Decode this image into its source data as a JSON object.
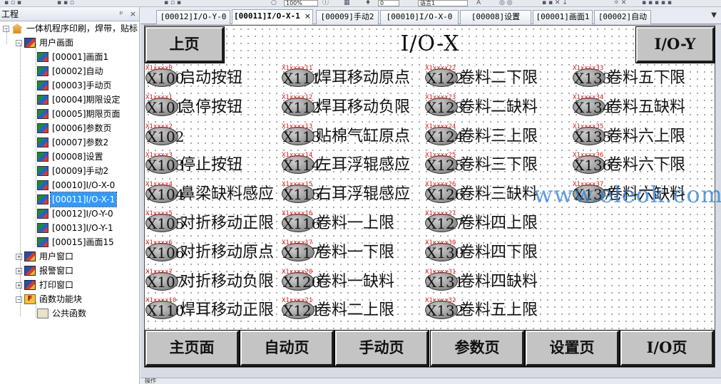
{
  "toolbar": {
    "zoom_value": "100%",
    "counter_value": "0",
    "language_value": "语言1"
  },
  "project_panel": {
    "title": "工程",
    "pin_glyph": "ᵖ",
    "close_glyph": "×",
    "tree": [
      {
        "label": "一体机程序印刷，焊带，贴标",
        "level": 0,
        "icon": "home-icon",
        "expander": "−"
      },
      {
        "label": "用户画面",
        "level": 1,
        "icon": "folder-icon",
        "expander": "−"
      },
      {
        "label": "[00001]画面1",
        "level": 2,
        "icon": "screen-icon"
      },
      {
        "label": "[00002]自动",
        "level": 2,
        "icon": "screen-icon"
      },
      {
        "label": "[00003]手动页",
        "level": 2,
        "icon": "screen-icon"
      },
      {
        "label": "[00004]期限设定",
        "level": 2,
        "icon": "screen-icon"
      },
      {
        "label": "[00005]期限页面",
        "level": 2,
        "icon": "screen-icon"
      },
      {
        "label": "[00006]参数页",
        "level": 2,
        "icon": "screen-icon"
      },
      {
        "label": "[00007]参数2",
        "level": 2,
        "icon": "screen-icon"
      },
      {
        "label": "[00008]设置",
        "level": 2,
        "icon": "screen-icon"
      },
      {
        "label": "[00009]手动2",
        "level": 2,
        "icon": "screen-icon"
      },
      {
        "label": "[00010]I/O-X-0",
        "level": 2,
        "icon": "screen-icon"
      },
      {
        "label": "[00011]I/O-X-1",
        "level": 2,
        "icon": "screen-icon",
        "selected": true
      },
      {
        "label": "[00012]I/O-Y-0",
        "level": 2,
        "icon": "screen-icon"
      },
      {
        "label": "[00013]I/O-Y-1",
        "level": 2,
        "icon": "screen-icon"
      },
      {
        "label": "[00015]画面15",
        "level": 2,
        "icon": "screen-icon"
      },
      {
        "label": "用户窗口",
        "level": 1,
        "icon": "folder-icon",
        "expander": "+"
      },
      {
        "label": "报警窗口",
        "level": 1,
        "icon": "folder-icon",
        "expander": "+"
      },
      {
        "label": "打印窗口",
        "level": 1,
        "icon": "folder-icon",
        "expander": "+"
      },
      {
        "label": "函数功能块",
        "level": 1,
        "icon": "function-icon",
        "expander": "−"
      },
      {
        "label": "公共函数",
        "level": 2,
        "icon": "document-icon"
      }
    ]
  },
  "tabs": [
    {
      "label": "[00012]I/O-Y-0",
      "active": false
    },
    {
      "label": "[00011]I/O-X-1",
      "active": true,
      "close": "×"
    },
    {
      "label": "[00009]手动2",
      "active": false
    },
    {
      "label": "[00010]I/O-X-0",
      "active": false
    },
    {
      "label": "[00008]设置",
      "active": false
    },
    {
      "label": "[00001]画面1",
      "active": false
    },
    {
      "label": "[00002]自动",
      "active": false
    }
  ],
  "tab_dropdown_glyph": "▼",
  "screen": {
    "title": "I/O-X",
    "prev_button": "上页",
    "next_button": "I/O-Y",
    "columns": [
      [
        {
          "addr": "X1xxxx0",
          "code": "X100",
          "desc": "启动按钮"
        },
        {
          "addr": "X1xxxx1",
          "code": "X101",
          "desc": "急停按钮"
        },
        {
          "addr": "X1xxxx2",
          "code": "X102",
          "desc": ""
        },
        {
          "addr": "X1xxxx3",
          "code": "X103",
          "desc": "停止按钮"
        },
        {
          "addr": "X1xxxx4",
          "code": "X104",
          "desc": "鼻梁缺料感应"
        },
        {
          "addr": "X1xxxx5",
          "code": "X105",
          "desc": "对折移动正限"
        },
        {
          "addr": "X1xxxx6",
          "code": "X106",
          "desc": "对折移动原点"
        },
        {
          "addr": "X1xxxx7",
          "code": "X107",
          "desc": "对折移动负限"
        },
        {
          "addr": "X1xxxx10",
          "code": "X110",
          "desc": "焊耳移动正限"
        }
      ],
      [
        {
          "addr": "X1xxxx11",
          "code": "X111",
          "desc": "焊耳移动原点"
        },
        {
          "addr": "X1xxxx12",
          "code": "X112",
          "desc": "焊耳移动负限"
        },
        {
          "addr": "X1xxxx13",
          "code": "X113",
          "desc": "贴棉气缸原点"
        },
        {
          "addr": "X1xxxx14",
          "code": "X114",
          "desc": "左耳浮辊感应"
        },
        {
          "addr": "X1xxxx15",
          "code": "X115",
          "desc": "右耳浮辊感应"
        },
        {
          "addr": "X1xxxx16",
          "code": "X116",
          "desc": "卷料一上限"
        },
        {
          "addr": "X1xxxx17",
          "code": "X117",
          "desc": "卷料一下限"
        },
        {
          "addr": "X1xxxx20",
          "code": "X120",
          "desc": "卷料一缺料"
        },
        {
          "addr": "X1xxxx21",
          "code": "X121",
          "desc": "卷料二上限"
        }
      ],
      [
        {
          "addr": "X1xxxx22",
          "code": "X122",
          "desc": "卷料二下限"
        },
        {
          "addr": "X1xxxx23",
          "code": "X123",
          "desc": "卷料二缺料"
        },
        {
          "addr": "X1xxxx24",
          "code": "X124",
          "desc": "卷料三上限"
        },
        {
          "addr": "X1xxxx25",
          "code": "X125",
          "desc": "卷料三下限"
        },
        {
          "addr": "X1xxxx26",
          "code": "X126",
          "desc": "卷料三缺料"
        },
        {
          "addr": "X1xxxx27",
          "code": "X127",
          "desc": "卷料四上限"
        },
        {
          "addr": "X1xxxx30",
          "code": "X130",
          "desc": "卷料四下限"
        },
        {
          "addr": "X1xxxx31",
          "code": "X131",
          "desc": "卷料四缺料"
        },
        {
          "addr": "X1xxxx32",
          "code": "X132",
          "desc": "卷料五上限"
        }
      ],
      [
        {
          "addr": "X1xxxx33",
          "code": "X133",
          "desc": "卷料五下限"
        },
        {
          "addr": "X1xxxx34",
          "code": "X134",
          "desc": "卷料五缺料"
        },
        {
          "addr": "X1xxxx35",
          "code": "X135",
          "desc": "卷料六上限"
        },
        {
          "addr": "X1xxxx36",
          "code": "X136",
          "desc": "卷料六下限"
        },
        {
          "addr": "X1xxxx37",
          "code": "X137",
          "desc": "卷料六缺料"
        }
      ]
    ],
    "nav_buttons": [
      "主页面",
      "自动页",
      "手动页",
      "参数页",
      "设置页",
      "I/O页"
    ]
  },
  "watermark": "www.eleok.com",
  "statusbar": {
    "label": "操作"
  }
}
